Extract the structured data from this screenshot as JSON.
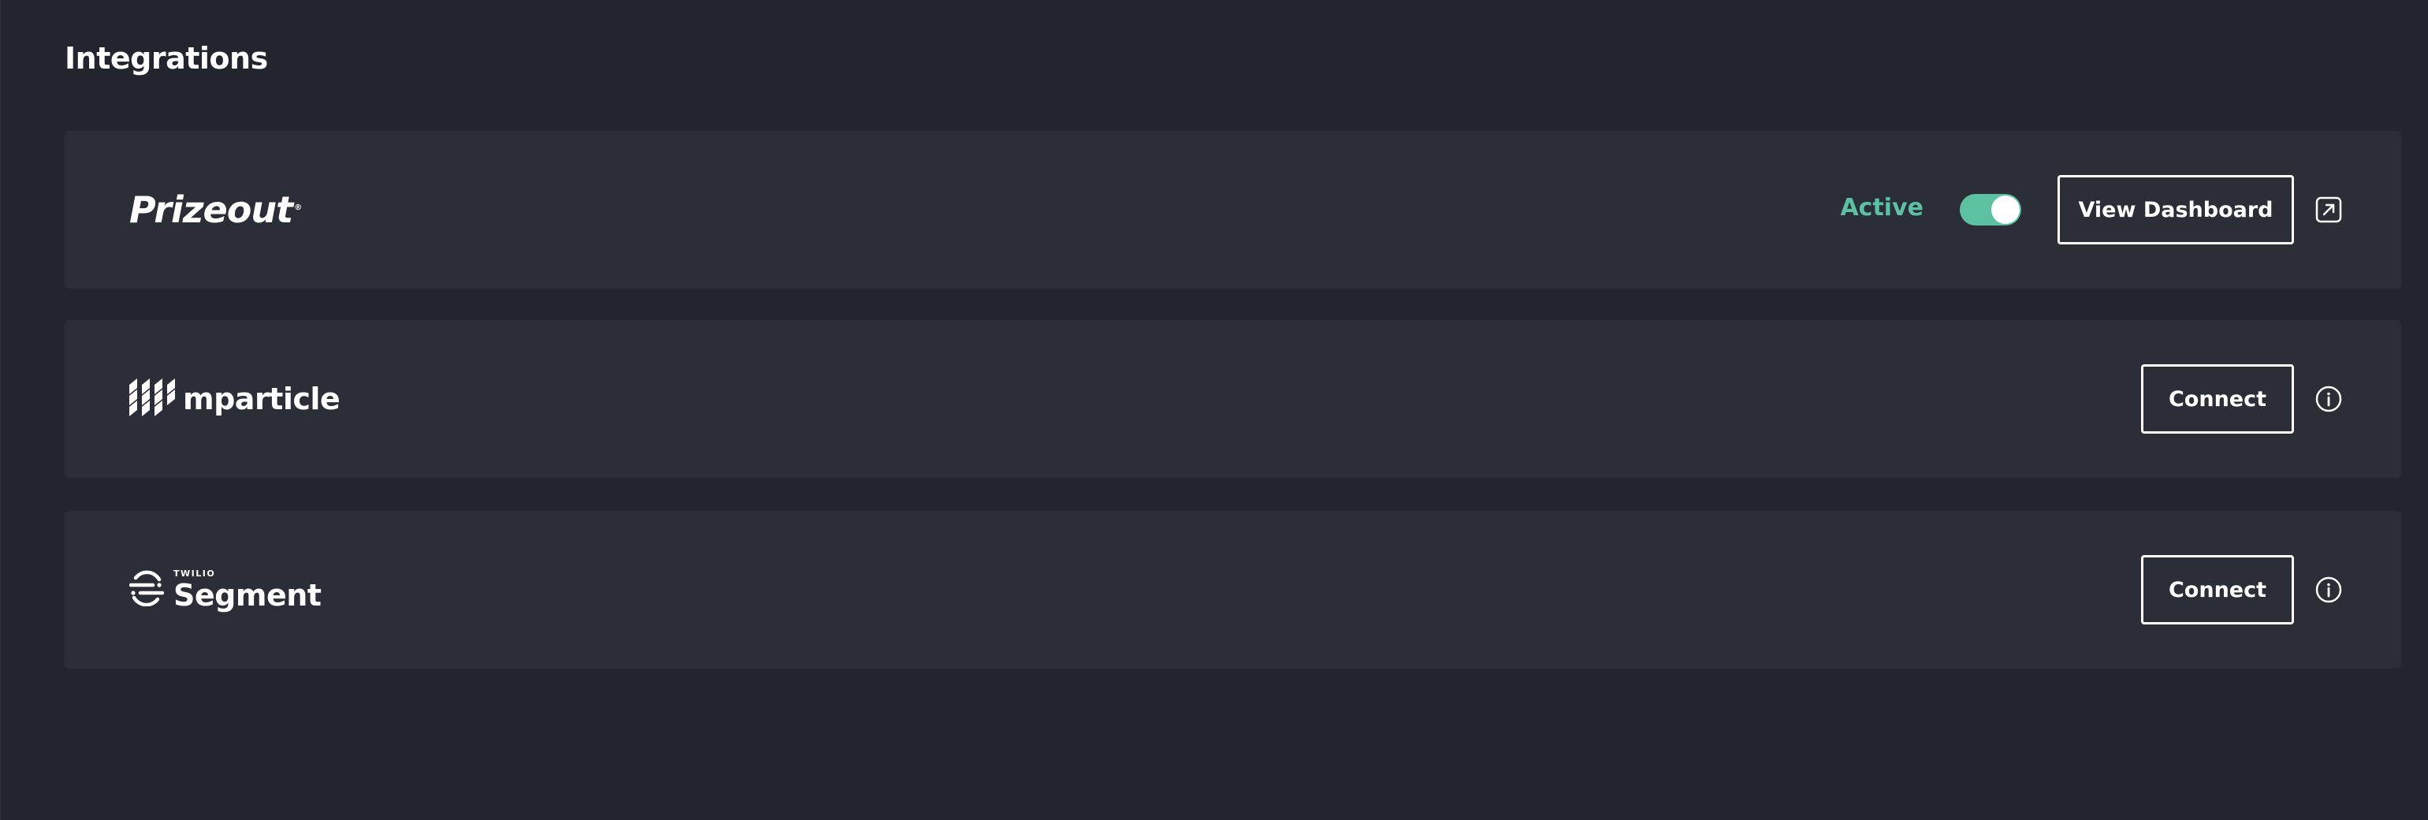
{
  "page": {
    "title": "Integrations"
  },
  "colors": {
    "background": "#22252d",
    "card": "#2b2e37",
    "accent_active": "#5bc1a2",
    "text": "#ffffff"
  },
  "integrations": [
    {
      "name": "Prizeout",
      "logo_text": "Prizeout",
      "logo_mark": "®",
      "status": "Active",
      "toggle_on": true,
      "action_label": "View Dashboard",
      "trailing_icon": "external-link-icon"
    },
    {
      "name": "mparticle",
      "logo_text": "mparticle",
      "logo_icon": "mparticle-logo-icon",
      "action_label": "Connect",
      "trailing_icon": "info-icon"
    },
    {
      "name": "Segment",
      "logo_sup": "TWILIO",
      "logo_text": "Segment",
      "logo_icon": "segment-logo-icon",
      "action_label": "Connect",
      "trailing_icon": "info-icon"
    }
  ]
}
